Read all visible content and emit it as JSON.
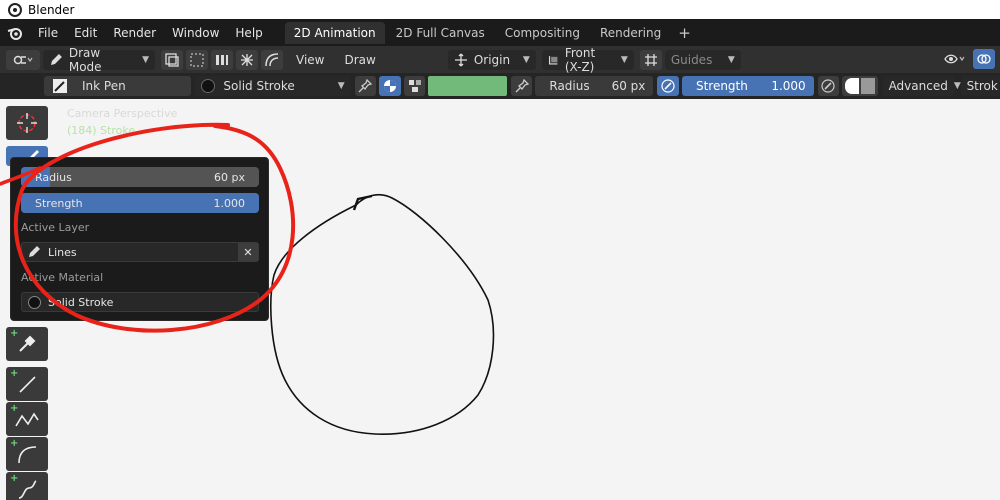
{
  "window": {
    "title": "Blender"
  },
  "menubar": {
    "items": [
      "File",
      "Edit",
      "Render",
      "Window",
      "Help"
    ],
    "workspace_tabs": [
      {
        "label": "2D Animation",
        "active": true
      },
      {
        "label": "2D Full Canvas",
        "active": false
      },
      {
        "label": "Compositing",
        "active": false
      },
      {
        "label": "Rendering",
        "active": false
      }
    ],
    "add_tab": "+"
  },
  "header": {
    "mode": "Draw Mode",
    "view_menu": "View",
    "draw_menu": "Draw",
    "origin": "Origin",
    "orientation": "Front (X-Z)",
    "guides": "Guides"
  },
  "toolsettings": {
    "brush": "Ink Pen",
    "material": "Solid Stroke",
    "color_swatch": "#72ba7a",
    "radius_label": "Radius",
    "radius_value": "60 px",
    "strength_label": "Strength",
    "strength_value": "1.000",
    "advanced": "Advanced",
    "stroke_cut": "Strok"
  },
  "viewport": {
    "camera_label": "Camera Perspective",
    "camera_sub": "(184) Stroke"
  },
  "popover": {
    "radius_label": "Radius",
    "radius_value": "60 px",
    "radius_fraction": 0.12,
    "strength_label": "Strength",
    "strength_value": "1.000",
    "strength_fraction": 1.0,
    "active_layer_label": "Active Layer",
    "active_layer_value": "Lines",
    "active_material_label": "Active Material",
    "active_material_value": "Solid Stroke"
  },
  "colors": {
    "accent_blue": "#4772b3",
    "annotation_red": "#e8231a",
    "stroke_black": "#111111"
  }
}
